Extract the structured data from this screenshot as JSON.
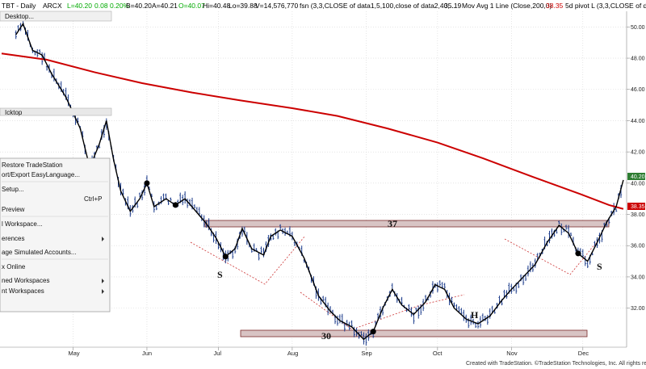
{
  "header": {
    "symbol": "TBT - Daily",
    "exchange": "ARCX",
    "last": "L=40.20",
    "change": "0.08",
    "change_pct": "0.20%",
    "bid": "B=40.20",
    "ask": "A=40.21",
    "open": "O=40.07",
    "high": "Hi=40.48",
    "low": "Lo=39.88",
    "volume": "V=14,576,770",
    "study1": "fsn (3,3,CLOSE of data1,5,100,close of data2,40,...",
    "study1_value": "35.19",
    "study2": "Mov Avg 1 Line (Close,200,0)",
    "study2_value": "38.35",
    "study3": "5d pivot L (3,3,CLOSE of da",
    "price_color": "#00aa00",
    "ma_color": "#cc0000"
  },
  "desktop_tab": "Desktop...",
  "second_tab": "Icktop",
  "context_menu": {
    "items": [
      {
        "label": "Restore TradeStation",
        "shortcut": ""
      },
      {
        "label": "ort/Export EasyLanguage...",
        "shortcut": ""
      },
      {
        "label": "Setup...",
        "shortcut": ""
      },
      {
        "label": "",
        "shortcut": "Ctrl+P"
      },
      {
        "label": "Preview",
        "shortcut": ""
      },
      {
        "label": "l Workspace...",
        "shortcut": ""
      },
      {
        "label": "erences",
        "shortcut": ""
      },
      {
        "label": "age Simulated Accounts...",
        "shortcut": ""
      },
      {
        "label": "x Online",
        "shortcut": ""
      },
      {
        "label": "ned Workspaces",
        "shortcut": ""
      },
      {
        "label": "nt Workspaces",
        "shortcut": ""
      }
    ]
  },
  "annotations": {
    "level_top": "37",
    "level_bottom": "30",
    "left_shoulder": "S",
    "head": "H",
    "right_shoulder": "S"
  },
  "footer": "Created with TradeStation. ©TradeStation Technologies, Inc. All rights reserved.",
  "price_tags": {
    "last": "40.20",
    "ma": "38.35"
  },
  "chart_data": {
    "type": "line",
    "title": "TBT - Daily",
    "x_tick_labels": [
      "May",
      "Jun",
      "Jul",
      "Aug",
      "Sep",
      "Oct",
      "Nov",
      "Dec"
    ],
    "y_tick_labels": [
      "32.00",
      "34.00",
      "36.00",
      "38.00",
      "40.00",
      "42.00",
      "44.00",
      "46.00",
      "48.00",
      "50.00"
    ],
    "ylim": [
      29.5,
      51
    ],
    "grid": true,
    "series": [
      {
        "name": "fsn (3,3,CLOSE of data1,5,100,close of data2,40,...",
        "x": [
          "Apr 7",
          "Apr 10",
          "Apr 14",
          "Apr 18",
          "Apr 22",
          "Apr 28",
          "May 4",
          "May 8",
          "May 12",
          "May 15",
          "May 18",
          "May 21",
          "May 25",
          "May 29",
          "Jun 1",
          "Jun 4",
          "Jun 9",
          "Jun 13",
          "Jun 17",
          "Jun 21",
          "Jun 26",
          "Jun 30",
          "Jul 4",
          "Jul 8",
          "Jul 11",
          "Jul 15",
          "Jul 20",
          "Jul 23",
          "Jul 27",
          "Aug 1",
          "Aug 6",
          "Aug 12",
          "Aug 17",
          "Aug 21",
          "Aug 26",
          "Aug 31",
          "Sep 4",
          "Sep 8",
          "Sep 12",
          "Sep 16",
          "Sep 21",
          "Sep 26",
          "Sep 30",
          "Oct 4",
          "Oct 8",
          "Oct 13",
          "Oct 18",
          "Oct 23",
          "Oct 28",
          "Nov 1",
          "Nov 6",
          "Nov 11",
          "Nov 16",
          "Nov 21",
          "Nov 25",
          "Nov 29",
          "Dec 3",
          "Dec 7",
          "Dec 11",
          "Dec 15",
          "Dec 18"
        ],
        "values": [
          49.5,
          50.2,
          48.5,
          48.2,
          47.0,
          45.5,
          43.5,
          41.0,
          42.5,
          44.0,
          41.5,
          39.5,
          38.2,
          39.0,
          40.0,
          38.5,
          39.0,
          38.6,
          39.0,
          38.3,
          37.4,
          36.5,
          35.3,
          35.8,
          37.1,
          35.8,
          35.4,
          36.6,
          37.0,
          36.6,
          35.2,
          32.8,
          31.8,
          31.2,
          30.8,
          30.0,
          30.5,
          32.0,
          33.2,
          32.2,
          31.6,
          32.4,
          33.5,
          33.2,
          32.0,
          31.3,
          31.0,
          31.5,
          32.5,
          33.2,
          34.0,
          34.8,
          36.2,
          37.3,
          36.8,
          35.5,
          35.0,
          36.2,
          37.5,
          38.5,
          40.2
        ]
      },
      {
        "name": "Mov Avg 1 Line (Close,200,0)",
        "x": [
          "Apr 1",
          "Apr 20",
          "May 10",
          "May 30",
          "Jun 20",
          "Jul 10",
          "Aug 1",
          "Aug 20",
          "Sep 10",
          "Oct 1",
          "Oct 20",
          "Nov 10",
          "Nov 30",
          "Dec 12",
          "Dec 18"
        ],
        "values": [
          48.3,
          47.9,
          47.1,
          46.4,
          45.8,
          45.3,
          44.8,
          44.3,
          43.5,
          42.6,
          41.6,
          40.4,
          39.3,
          38.6,
          38.35
        ]
      }
    ]
  }
}
